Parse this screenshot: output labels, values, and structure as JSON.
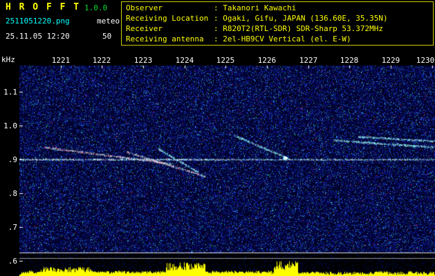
{
  "app": {
    "title": "H R O F F T",
    "version": "1.0.0",
    "filename": "2511051220.png",
    "mode": "meteor",
    "datetime": "25.11.05 12:20",
    "gain": "50"
  },
  "info": {
    "rows": [
      {
        "label": "Observer",
        "value": ": Takanori Kawachi"
      },
      {
        "label": "Receiving Location",
        "value": ": Ogaki, Gifu, JAPAN (136.60E, 35.35N)"
      },
      {
        "label": "Receiver",
        "value": ": R820T2(RTL-SDR) SDR-Sharp 53.372MHz"
      },
      {
        "label": "Receiving antenna",
        "value": ": 2el-HB9CV Vertical (el. E-W)"
      }
    ]
  },
  "chart_data": {
    "type": "heatmap",
    "description": "HROFFT 10-minute radio meteor echo spectrogram (waterfall) with signal-level meter strip at bottom",
    "x_range": [
      1220,
      1230.07
    ],
    "x_ticks": [
      "1221",
      "1222",
      "1223",
      "1224",
      "1225",
      "1226",
      "1227",
      "1228",
      "1229",
      "1230"
    ],
    "y_label": "kHz",
    "y_ticks": [
      "1.1",
      "1.0",
      ".9",
      ".8",
      ".7",
      ".6"
    ],
    "y_tick_values": [
      1.1,
      1.0,
      0.9,
      0.8,
      0.7,
      0.6
    ],
    "y_range": [
      0.556,
      1.178
    ],
    "noise_region_khz": [
      0.627,
      1.178
    ],
    "carrier_line_khz": 0.9,
    "meter_lines_khz": [
      0.625,
      0.609
    ],
    "echo_traces": [
      {
        "t1": 1220.6,
        "f1": 0.937,
        "t2": 1223.7,
        "f2": 0.888,
        "tint": "pink"
      },
      {
        "t1": 1222.6,
        "f1": 0.923,
        "t2": 1224.5,
        "f2": 0.851,
        "tint": "pink"
      },
      {
        "t1": 1223.35,
        "f1": 0.933,
        "t2": 1224.35,
        "f2": 0.862,
        "tint": "cyan"
      },
      {
        "t1": 1225.2,
        "f1": 0.972,
        "t2": 1226.45,
        "f2": 0.907,
        "tint": "cyan"
      },
      {
        "t1": 1227.6,
        "f1": 0.958,
        "t2": 1230.05,
        "f2": 0.937,
        "tint": "cyan"
      },
      {
        "t1": 1228.2,
        "f1": 0.968,
        "t2": 1230.05,
        "f2": 0.955,
        "tint": "cyan"
      }
    ],
    "bright_spot": {
      "t": 1226.45,
      "f": 0.905
    },
    "meter_base_h": 4,
    "meter_bursts": [
      {
        "t1": 1220.15,
        "t2": 1220.5,
        "h": 7
      },
      {
        "t1": 1220.5,
        "t2": 1221.75,
        "h": 12
      },
      {
        "t1": 1221.75,
        "t2": 1223.55,
        "h": 7
      },
      {
        "t1": 1223.55,
        "t2": 1224.5,
        "h": 18
      },
      {
        "t1": 1224.5,
        "t2": 1226.1,
        "h": 7
      },
      {
        "t1": 1226.15,
        "t2": 1226.75,
        "h": 20
      },
      {
        "t1": 1226.75,
        "t2": 1227.4,
        "h": 6
      },
      {
        "t1": 1228.6,
        "t2": 1228.9,
        "h": 7
      },
      {
        "t1": 1229.4,
        "t2": 1229.6,
        "h": 7
      }
    ],
    "colors": {
      "background": "#000000",
      "noise_blue": "#0000c8",
      "trace_cyan": "#66ffff",
      "trace_pink": "#ff8899",
      "meter_yellow": "#ffff00",
      "meter_line": "#c8c8c8"
    }
  }
}
